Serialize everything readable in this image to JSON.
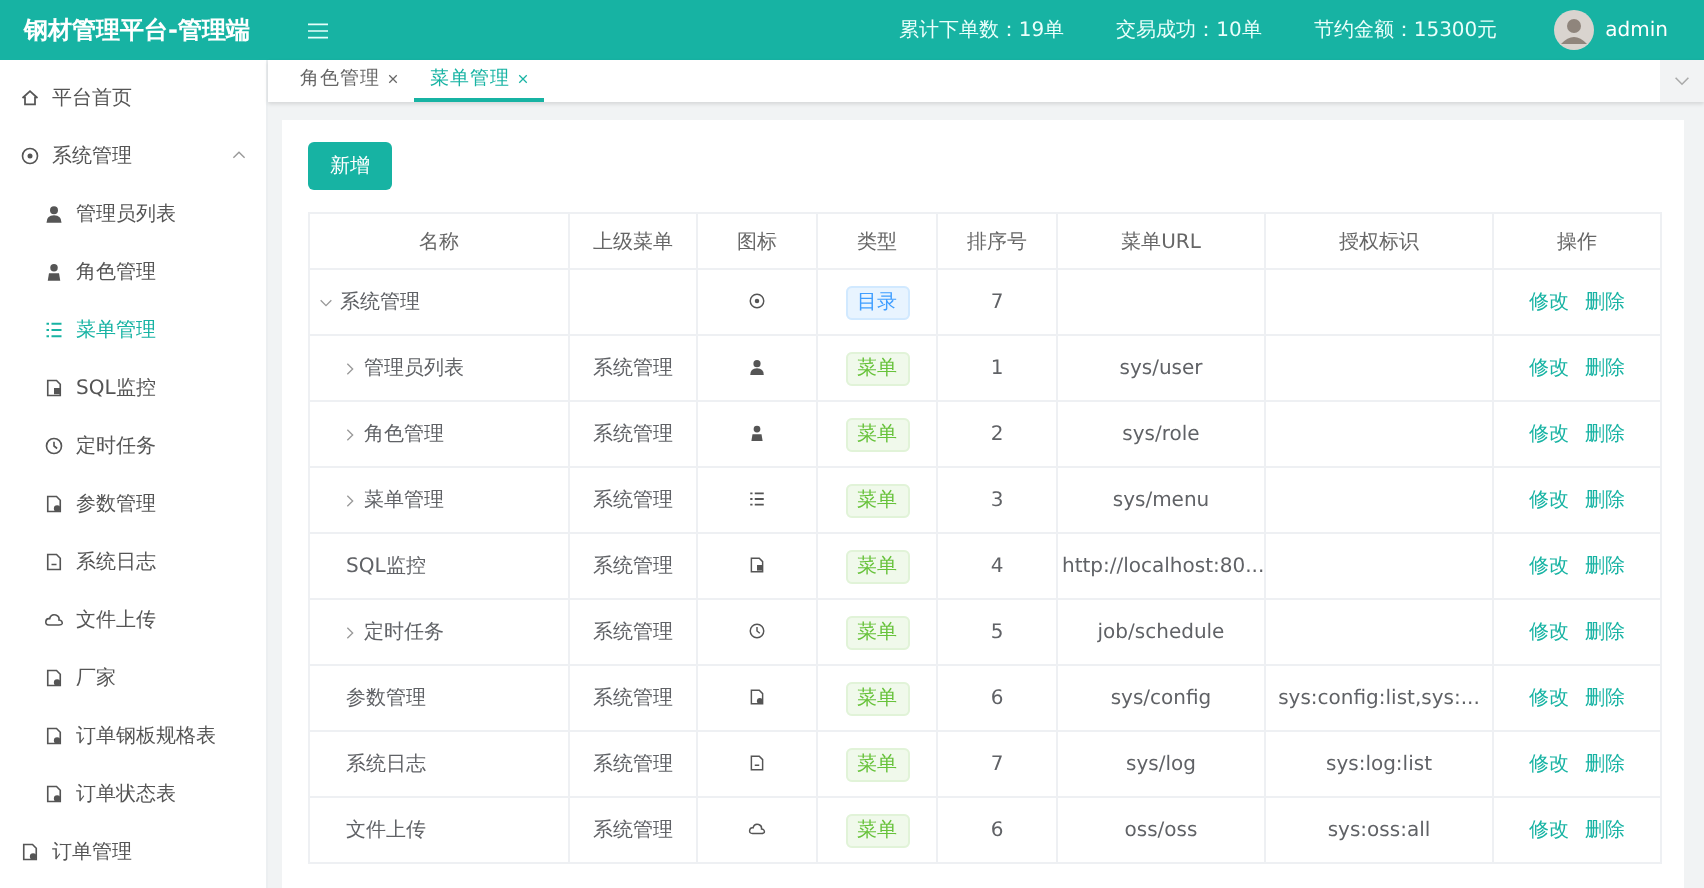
{
  "header": {
    "title": "钢材管理平台-管理端",
    "stats": [
      "累计下单数：19单",
      "交易成功：10单",
      "节约金额：15300元"
    ],
    "user": "admin"
  },
  "tabs": [
    {
      "label": "角色管理",
      "selected": false
    },
    {
      "label": "菜单管理",
      "selected": true
    }
  ],
  "sidebar": {
    "items": [
      {
        "label": "平台首页",
        "kind": "home",
        "selected": false
      },
      {
        "label": "系统管理",
        "kind": "target",
        "selected": false,
        "expanded": true,
        "children": [
          {
            "label": "管理员列表",
            "kind": "user",
            "selected": false
          },
          {
            "label": "角色管理",
            "kind": "user-tie",
            "selected": false
          },
          {
            "label": "菜单管理",
            "kind": "list",
            "selected": true
          },
          {
            "label": "SQL监控",
            "kind": "doc",
            "selected": false
          },
          {
            "label": "定时任务",
            "kind": "clock",
            "selected": false
          },
          {
            "label": "参数管理",
            "kind": "doc-gear",
            "selected": false
          },
          {
            "label": "系统日志",
            "kind": "file",
            "selected": false
          },
          {
            "label": "文件上传",
            "kind": "cloud",
            "selected": false
          },
          {
            "label": "厂家",
            "kind": "doc-gear",
            "selected": false
          },
          {
            "label": "订单钢板规格表",
            "kind": "doc-gear",
            "selected": false
          },
          {
            "label": "订单状态表",
            "kind": "doc-gear",
            "selected": false
          }
        ]
      },
      {
        "label": "订单管理",
        "kind": "doc-gear",
        "selected": false
      }
    ]
  },
  "toolbar": {
    "add_button": "新增"
  },
  "table": {
    "columns": [
      "名称",
      "上级菜单",
      "图标",
      "类型",
      "排序号",
      "菜单URL",
      "授权标识",
      "操作"
    ],
    "rows": [
      {
        "name": "系统管理",
        "kind": "target",
        "type": {
          "label": "目录",
          "kind": "directory"
        },
        "order": "7",
        "expanded": true,
        "actions": [
          "修改",
          "删除"
        ],
        "children": [
          {
            "name": "管理员列表",
            "parent": "系统管理",
            "kind": "user",
            "type": {
              "label": "菜单",
              "kind": "menu"
            },
            "order": "1",
            "url": "sys/user",
            "expanded": false,
            "actions": [
              "修改",
              "删除"
            ]
          },
          {
            "name": "角色管理",
            "parent": "系统管理",
            "kind": "user-tie",
            "type": {
              "label": "菜单",
              "kind": "menu"
            },
            "order": "2",
            "url": "sys/role",
            "expanded": false,
            "actions": [
              "修改",
              "删除"
            ]
          },
          {
            "name": "菜单管理",
            "parent": "系统管理",
            "kind": "list",
            "type": {
              "label": "菜单",
              "kind": "menu"
            },
            "order": "3",
            "url": "sys/menu",
            "expanded": false,
            "actions": [
              "修改",
              "删除"
            ]
          },
          {
            "name": "SQL监控",
            "parent": "系统管理",
            "kind": "doc",
            "type": {
              "label": "菜单",
              "kind": "menu"
            },
            "order": "4",
            "url": "http://localhost:80...",
            "actions": [
              "修改",
              "删除"
            ]
          },
          {
            "name": "定时任务",
            "parent": "系统管理",
            "kind": "clock",
            "type": {
              "label": "菜单",
              "kind": "menu"
            },
            "order": "5",
            "url": "job/schedule",
            "expanded": false,
            "actions": [
              "修改",
              "删除"
            ]
          },
          {
            "name": "参数管理",
            "parent": "系统管理",
            "kind": "doc-gear",
            "type": {
              "label": "菜单",
              "kind": "menu"
            },
            "order": "6",
            "url": "sys/config",
            "perm": "sys:config:list,sys:...",
            "actions": [
              "修改",
              "删除"
            ]
          },
          {
            "name": "系统日志",
            "parent": "系统管理",
            "kind": "file",
            "type": {
              "label": "菜单",
              "kind": "menu"
            },
            "order": "7",
            "url": "sys/log",
            "perm": "sys:log:list",
            "actions": [
              "修改",
              "删除"
            ]
          },
          {
            "name": "文件上传",
            "parent": "系统管理",
            "kind": "cloud",
            "type": {
              "label": "菜单",
              "kind": "menu"
            },
            "order": "6",
            "url": "oss/oss",
            "perm": "sys:oss:all",
            "actions": [
              "修改",
              "删除"
            ]
          }
        ]
      }
    ]
  }
}
